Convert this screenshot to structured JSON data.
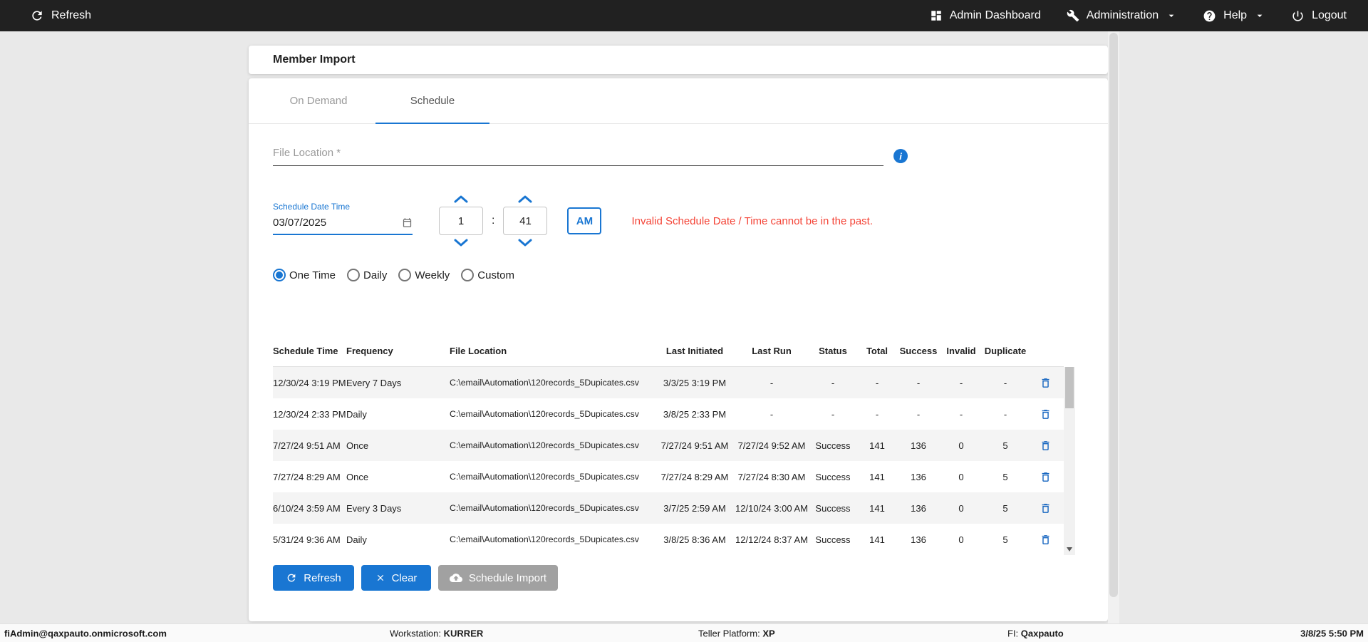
{
  "topbar": {
    "refresh_label": "Refresh",
    "admin_dashboard_label": "Admin Dashboard",
    "administration_label": "Administration",
    "help_label": "Help",
    "logout_label": "Logout"
  },
  "page": {
    "title": "Member Import"
  },
  "tabs": {
    "on_demand": "On Demand",
    "schedule": "Schedule"
  },
  "form": {
    "file_location_label": "File Location *",
    "schedule_date_time_label": "Schedule Date Time",
    "date_value": "03/07/2025",
    "hour": "1",
    "time_separator": ":",
    "minute": "41",
    "meridiem": "AM",
    "error": "Invalid Schedule Date / Time cannot be in the past.",
    "frequency_options": [
      {
        "label": "One Time",
        "selected": true
      },
      {
        "label": "Daily",
        "selected": false
      },
      {
        "label": "Weekly",
        "selected": false
      },
      {
        "label": "Custom",
        "selected": false
      }
    ]
  },
  "table": {
    "headers": [
      "Schedule Time",
      "Frequency",
      "File Location",
      "Last Initiated",
      "Last Run",
      "Status",
      "Total",
      "Success",
      "Invalid",
      "Duplicate"
    ],
    "rows": [
      [
        "12/30/24 3:19 PM",
        "Every 7 Days",
        "C:\\email\\Automation\\120records_5Dupicates.csv",
        "3/3/25 3:19 PM",
        "-",
        "-",
        "-",
        "-",
        "-",
        "-"
      ],
      [
        "12/30/24 2:33 PM",
        "Daily",
        "C:\\email\\Automation\\120records_5Dupicates.csv",
        "3/8/25 2:33 PM",
        "-",
        "-",
        "-",
        "-",
        "-",
        "-"
      ],
      [
        "7/27/24 9:51 AM",
        "Once",
        "C:\\email\\Automation\\120records_5Dupicates.csv",
        "7/27/24 9:51 AM",
        "7/27/24 9:52 AM",
        "Success",
        "141",
        "136",
        "0",
        "5"
      ],
      [
        "7/27/24 8:29 AM",
        "Once",
        "C:\\email\\Automation\\120records_5Dupicates.csv",
        "7/27/24 8:29 AM",
        "7/27/24 8:30 AM",
        "Success",
        "141",
        "136",
        "0",
        "5"
      ],
      [
        "6/10/24 3:59 AM",
        "Every 3 Days",
        "C:\\email\\Automation\\120records_5Dupicates.csv",
        "3/7/25 2:59 AM",
        "12/10/24 3:00 AM",
        "Success",
        "141",
        "136",
        "0",
        "5"
      ],
      [
        "5/31/24 9:36 AM",
        "Daily",
        "C:\\email\\Automation\\120records_5Dupicates.csv",
        "3/8/25 8:36 AM",
        "12/12/24 8:37 AM",
        "Success",
        "141",
        "136",
        "0",
        "5"
      ]
    ]
  },
  "actions": {
    "refresh_label": "Refresh",
    "clear_label": "Clear",
    "schedule_import_label": "Schedule Import"
  },
  "footer": {
    "user_email": "fiAdmin@qaxpauto.onmicrosoft.com",
    "workstation_label": "Workstation:",
    "workstation_value": "KURRER",
    "teller_platform_label": "Teller Platform:",
    "teller_platform_value": "XP",
    "fi_label": "FI:",
    "fi_value": "Qaxpauto",
    "datetime": "3/8/25 5:50 PM"
  },
  "colors": {
    "accent_blue": "#1976d2",
    "error_red": "#f44336",
    "topbar_background": "#212121",
    "disabled_gray": "#a1a1a1",
    "delete_icon_blue": "#1565c0"
  }
}
